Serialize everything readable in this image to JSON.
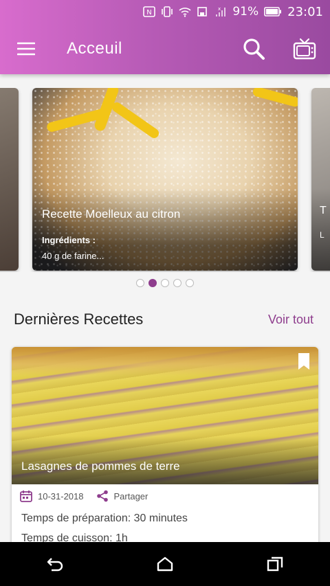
{
  "status_bar": {
    "battery_percent": "91%",
    "time": "23:01",
    "icons": [
      "nfc-icon",
      "vibrate-icon",
      "wifi-icon",
      "save-mode-icon",
      "signal-icon",
      "battery-icon"
    ]
  },
  "toolbar": {
    "title": "Acceuil",
    "menu_icon": "menu-icon",
    "search_icon": "search-icon",
    "tv_icon": "tv-icon",
    "gradient_start": "#d86ccd",
    "gradient_end": "#9a4aa0"
  },
  "carousel": {
    "active_index": 1,
    "dot_count": 5,
    "featured": {
      "title": "Recette Moelleux au citron",
      "ingredients_label": "Ingrédients :",
      "ingredients_value": "40 g de farine..."
    },
    "peek_right": {
      "title_initial": "T",
      "ingredients_initial": "L"
    }
  },
  "latest": {
    "section_title": "Dernières Recettes",
    "see_all": "Voir tout",
    "accent_color": "#8e3d8d",
    "recipe": {
      "title": "Lasagnes de pommes de terre",
      "date": "10-31-2018",
      "share_label": "Partager",
      "prep_time": "Temps de préparation: 30 minutes",
      "cook_time": "Temps de cuisson: 1h"
    }
  },
  "nav_bar": {
    "icons": [
      "back-icon",
      "home-icon",
      "recents-icon"
    ]
  }
}
